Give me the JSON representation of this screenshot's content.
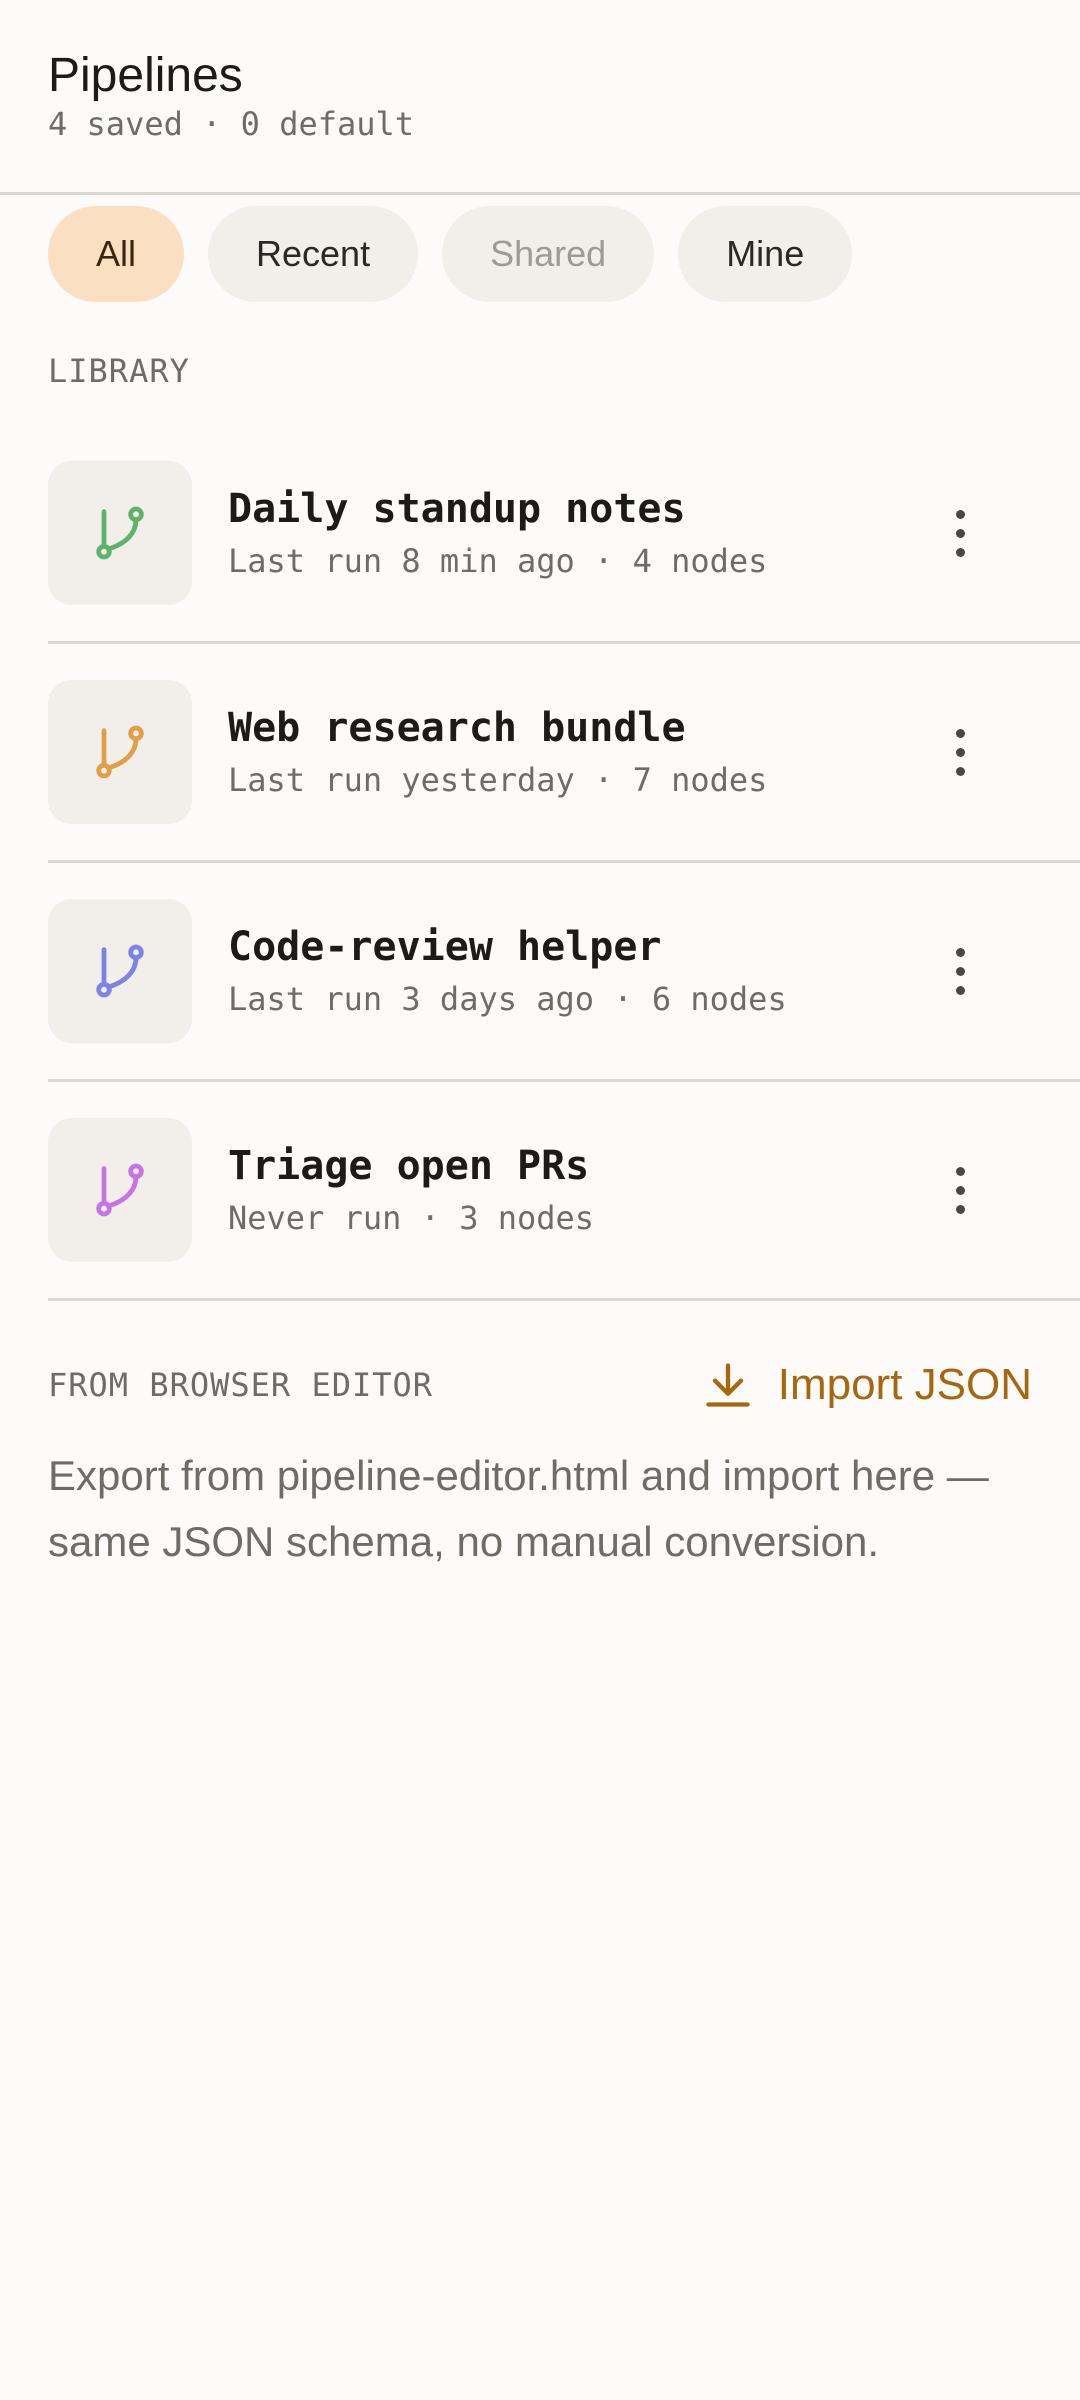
{
  "header": {
    "title": "Pipelines",
    "subtitle": "4 saved · 0 default"
  },
  "filters": [
    {
      "label": "All",
      "state": "active"
    },
    {
      "label": "Recent",
      "state": "normal"
    },
    {
      "label": "Shared",
      "state": "disabled"
    },
    {
      "label": "Mine",
      "state": "normal"
    }
  ],
  "library": {
    "label": "LIBRARY",
    "items": [
      {
        "title": "Daily standup notes",
        "meta": "Last run 8 min ago · 4 nodes",
        "icon": "branch-icon",
        "color": "#5fb26a"
      },
      {
        "title": "Web research bundle",
        "meta": "Last run yesterday · 7 nodes",
        "icon": "branch-icon",
        "color": "#e0a04a"
      },
      {
        "title": "Code-review helper",
        "meta": "Last run 3 days ago · 6 nodes",
        "icon": "branch-icon",
        "color": "#7b84e3"
      },
      {
        "title": "Triage open PRs",
        "meta": "Never run · 3 nodes",
        "icon": "branch-icon",
        "color": "#c774e3"
      }
    ]
  },
  "import": {
    "label": "FROM BROWSER EDITOR",
    "button_label": "Import JSON",
    "description": "Export from pipeline-editor.html and import here — same JSON schema, no manual conversion.",
    "accent": "#a6680f"
  }
}
